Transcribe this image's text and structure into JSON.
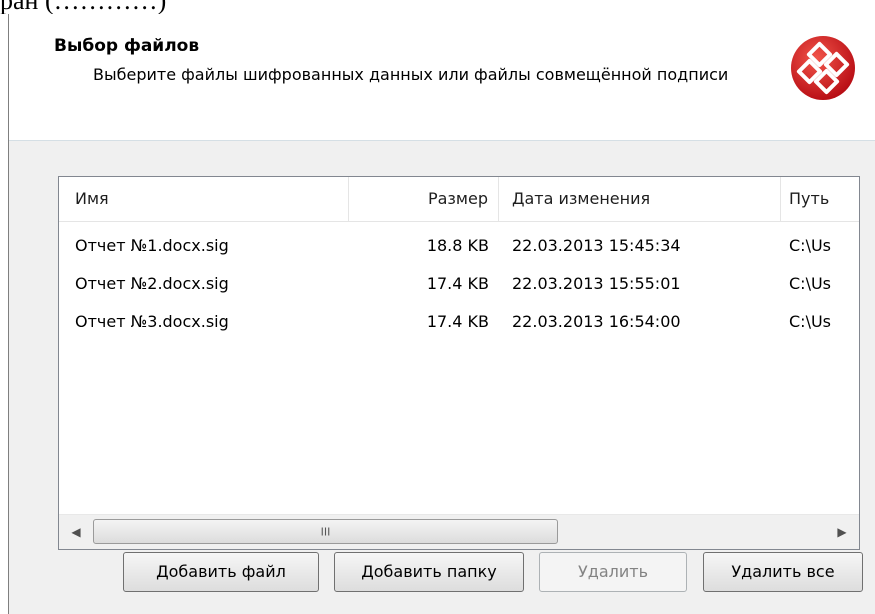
{
  "page_fragment": "ран (…………)",
  "header": {
    "title": "Выбор файлов",
    "subtitle": "Выберите файлы шифрованных данных или файлы совмещённой подписи"
  },
  "file_list": {
    "columns": [
      "Имя",
      "Размер",
      "Дата изменения",
      "Путь"
    ],
    "rows": [
      {
        "name": "Отчет №1.docx.sig",
        "size": "18.8 KB",
        "modified": "22.03.2013 15:45:34",
        "path": "C:\\Us"
      },
      {
        "name": "Отчет №2.docx.sig",
        "size": "17.4 KB",
        "modified": "22.03.2013 15:55:01",
        "path": "C:\\Us"
      },
      {
        "name": "Отчет №3.docx.sig",
        "size": "17.4 KB",
        "modified": "22.03.2013 16:54:00",
        "path": "C:\\Us"
      }
    ],
    "scrollbar_grip": "III"
  },
  "buttons": {
    "add_file": "Добавить файл",
    "add_folder": "Добавить папку",
    "delete": "Удалить",
    "delete_all": "Удалить все"
  },
  "colors": {
    "logo_red": "#d8141c",
    "logo_white": "#ffffff"
  },
  "icons": {
    "logo": "crypto-logo-icon",
    "scroll_left": "arrow-left-icon",
    "scroll_right": "arrow-right-icon"
  }
}
